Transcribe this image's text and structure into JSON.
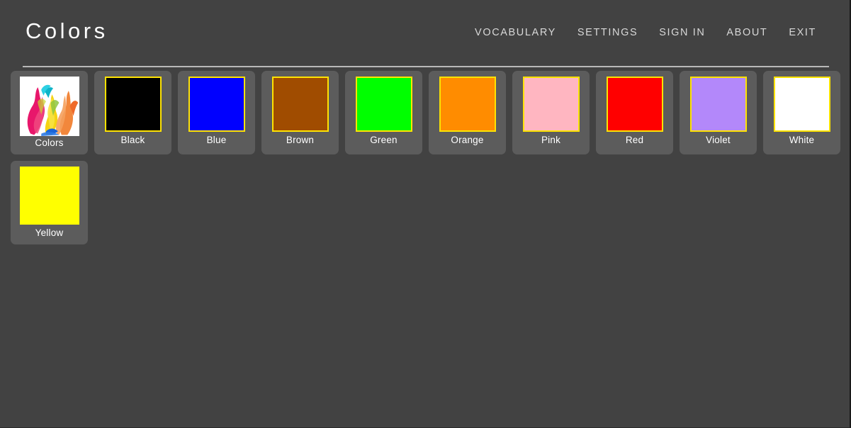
{
  "header": {
    "title": "Colors",
    "nav": [
      {
        "label": "VOCABULARY",
        "name": "nav-vocabulary"
      },
      {
        "label": "SETTINGS",
        "name": "nav-settings"
      },
      {
        "label": "SIGN IN",
        "name": "nav-sign-in"
      },
      {
        "label": "ABOUT",
        "name": "nav-about"
      },
      {
        "label": "EXIT",
        "name": "nav-exit"
      }
    ]
  },
  "theme": {
    "page_background": "#424242",
    "card_background": "#5c5c5c",
    "swatch_border": "#ffe300",
    "text": "#ffffff",
    "divider": "#b9b9b9"
  },
  "cards": [
    {
      "label": "Colors",
      "swatch_type": "photo",
      "color": "#ffffff",
      "bordered": false
    },
    {
      "label": "Black",
      "swatch_type": "color",
      "color": "#000000",
      "bordered": true
    },
    {
      "label": "Blue",
      "swatch_type": "color",
      "color": "#0000ff",
      "bordered": true
    },
    {
      "label": "Brown",
      "swatch_type": "color",
      "color": "#a04c00",
      "bordered": true
    },
    {
      "label": "Green",
      "swatch_type": "color",
      "color": "#00ff00",
      "bordered": true
    },
    {
      "label": "Orange",
      "swatch_type": "color",
      "color": "#ff8c00",
      "bordered": true
    },
    {
      "label": "Pink",
      "swatch_type": "color",
      "color": "#ffb6c1",
      "bordered": true
    },
    {
      "label": "Red",
      "swatch_type": "color",
      "color": "#ff0000",
      "bordered": true
    },
    {
      "label": "Violet",
      "swatch_type": "color",
      "color": "#b388fa",
      "bordered": true
    },
    {
      "label": "White",
      "swatch_type": "color",
      "color": "#ffffff",
      "bordered": true
    },
    {
      "label": "Yellow",
      "swatch_type": "color",
      "color": "#ffff00",
      "bordered": false
    }
  ]
}
